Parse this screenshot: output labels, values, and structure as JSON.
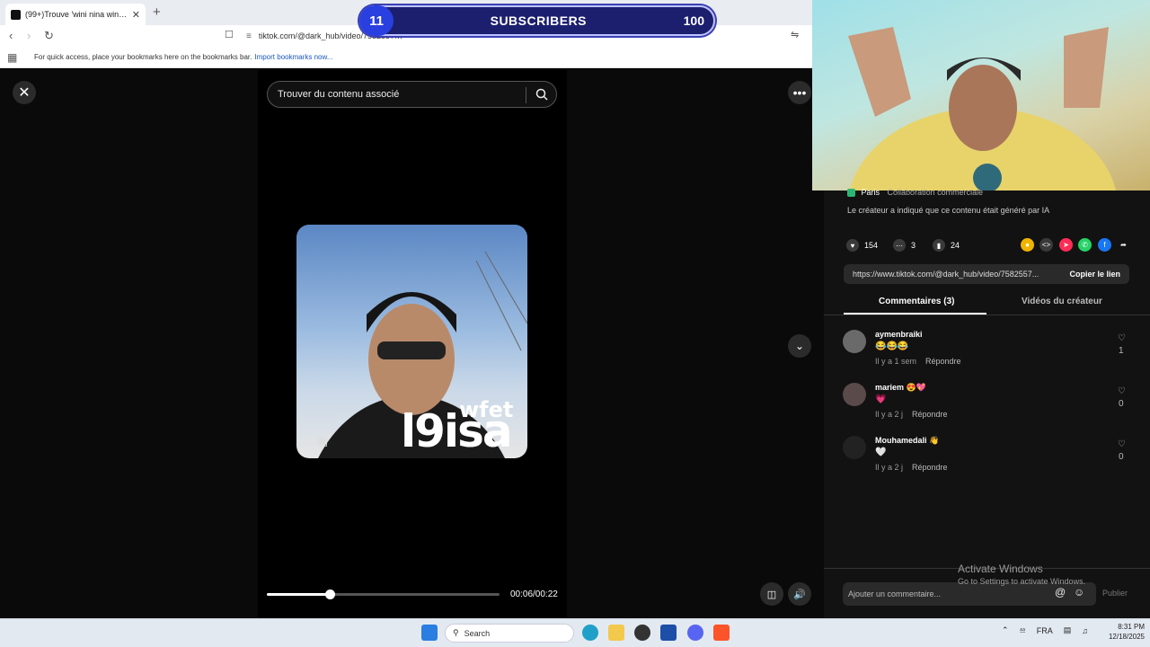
{
  "browser": {
    "tab_title": "(99+)Trouve 'wini nina wini k…",
    "tab_close": "✕",
    "new_tab": "+",
    "url": "tiktok.com/@dark_hub/video/7582557…",
    "bookmarks_msg": "For quick access, place your bookmarks here on the bookmarks bar.",
    "bookmarks_link": "Import bookmarks now..."
  },
  "overlay": {
    "subscribers_current": "11",
    "subscribers_label": "SUBSCRIBERS",
    "subscribers_goal": "100"
  },
  "viewer": {
    "search_placeholder": "Trouver du contenu associé",
    "caption_top": "wfet",
    "caption_main": "l9isa",
    "time": "00:06/00:22",
    "progress": 0.27
  },
  "panel": {
    "collab_tag": "Paris",
    "collab_text": "Collaboration commerciale",
    "ai_note": "Le créateur a indiqué que ce contenu était généré par IA",
    "likes": "154",
    "comments": "3",
    "saves": "24",
    "link_url": "https://www.tiktok.com/@dark_hub/video/7582557...",
    "copy_label": "Copier le lien",
    "tab_comments": "Commentaires (3)",
    "tab_creator": "Vidéos du créateur",
    "comments_list": [
      {
        "user": "aymenbraiki",
        "text": "😂😂😂",
        "age": "Il y a 1 sem",
        "reply": "Répondre",
        "likes": "1"
      },
      {
        "user": "mariem 😍💖",
        "text": "💗",
        "age": "Il y a 2 j",
        "reply": "Répondre",
        "likes": "0"
      },
      {
        "user": "Mouhamedali 👋",
        "text": "🤍",
        "age": "Il y a 2 j",
        "reply": "Répondre",
        "likes": "0"
      }
    ],
    "comment_placeholder": "Ajouter un commentaire...",
    "publish": "Publier"
  },
  "windows": {
    "activate_title": "Activate Windows",
    "activate_sub": "Go to Settings to activate Windows.",
    "search": "Search",
    "lang": "FRA",
    "time": "8:31 PM",
    "date": "12/18/2025"
  }
}
